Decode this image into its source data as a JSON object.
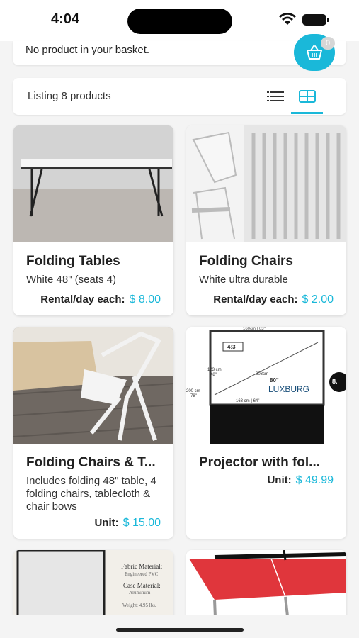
{
  "status_bar": {
    "time": "4:04"
  },
  "basket": {
    "message": "No product in your basket.",
    "count": "0"
  },
  "listing": {
    "summary": "Listing 8 products",
    "active_view": "grid"
  },
  "colors": {
    "accent": "#1ab8d9"
  },
  "products": [
    {
      "name": "Folding Tables",
      "description": "White 48\" (seats 4)",
      "price_label": "Rental/day each:",
      "price": "$ 8.00"
    },
    {
      "name": "Folding Chairs",
      "description": "White ultra durable",
      "price_label": "Rental/day each:",
      "price": "$ 2.00"
    },
    {
      "name": "Folding Chairs & T...",
      "description": "Includes folding 48\" table, 4 folding chairs, tablecloth & chair bows",
      "price_label": "Unit:",
      "price": "$ 15.00"
    },
    {
      "name": "Projector with fol...",
      "description": "",
      "price_label": "Unit:",
      "price": "$ 49.99"
    },
    {
      "name": "",
      "description": "",
      "price_label": "",
      "price": ""
    },
    {
      "name": "",
      "description": "",
      "price_label": "",
      "price": ""
    }
  ],
  "image_text": {
    "screen_aspect": "4:3",
    "screen_width": "163 cm | 64\"",
    "screen_height_cm": "200 cm",
    "screen_height_in": "78\"",
    "screen_diag": "203cm",
    "screen_diag_in": "80\"",
    "screen_inner": "123 cm",
    "screen_inner_in": "48\"",
    "screen_brand": "LUXBURG",
    "screen_top": "160cm | 63\"",
    "fabric_label": "Fabric Material:",
    "fabric_value": "Engineered PVC",
    "case_label": "Case Material:",
    "case_value": "Aluminum",
    "weight": "Weight: 4.95 lbs."
  }
}
